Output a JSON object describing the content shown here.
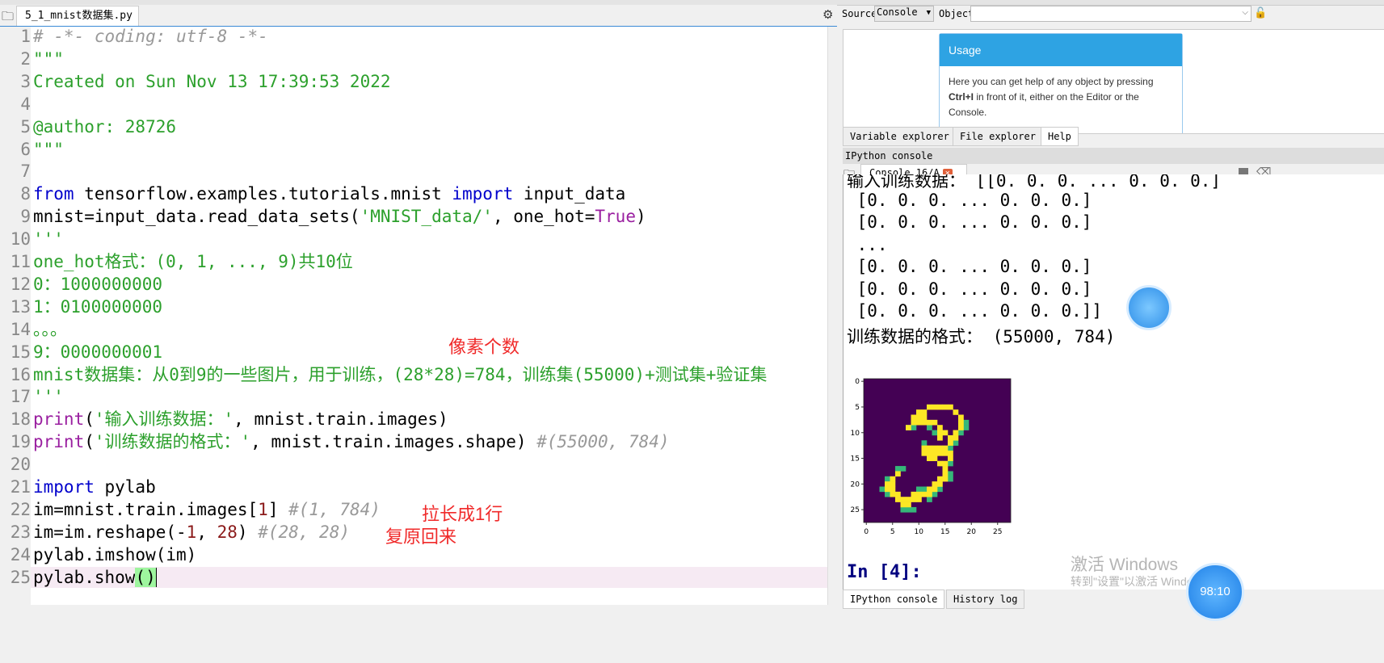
{
  "editor": {
    "file_tab": "5_1_mnist数据集.py",
    "cursor_line": 25,
    "lines": [
      [
        [
          "cm",
          "# -*- coding: utf-8 -*-"
        ]
      ],
      [
        [
          "st",
          "\"\"\""
        ]
      ],
      [
        [
          "st",
          "Created on Sun Nov 13 17:39:53 2022"
        ]
      ],
      [],
      [
        [
          "st",
          "@author: 28726"
        ]
      ],
      [
        [
          "st",
          "\"\"\""
        ]
      ],
      [],
      [
        [
          "kw",
          "from"
        ],
        [
          "pl",
          " tensorflow.examples.tutorials.mnist "
        ],
        [
          "kw",
          "import"
        ],
        [
          "pl",
          " input_data"
        ]
      ],
      [
        [
          "pl",
          "mnist=input_data.read_data_sets("
        ],
        [
          "st",
          "'MNIST_data/'"
        ],
        [
          "pl",
          ", one_hot="
        ],
        [
          "bi",
          "True"
        ],
        [
          "pl",
          ")"
        ]
      ],
      [
        [
          "st",
          "'''"
        ]
      ],
      [
        [
          "st",
          "one_hot格式：(0, 1, ..., 9)共10位"
        ]
      ],
      [
        [
          "st",
          "0：1000000000"
        ]
      ],
      [
        [
          "st",
          "1：0100000000"
        ]
      ],
      [
        [
          "st",
          "。。。"
        ]
      ],
      [
        [
          "st",
          "9：0000000001"
        ]
      ],
      [
        [
          "st",
          "mnist数据集：从0到9的一些图片，用于训练，(28*28)=784，训练集(55000)+测试集+验证集"
        ]
      ],
      [
        [
          "st",
          "'''"
        ]
      ],
      [
        [
          "bi",
          "print"
        ],
        [
          "pl",
          "("
        ],
        [
          "st",
          "'输入训练数据：'"
        ],
        [
          "pl",
          ", mnist.train.images)"
        ]
      ],
      [
        [
          "bi",
          "print"
        ],
        [
          "pl",
          "("
        ],
        [
          "st",
          "'训练数据的格式：'"
        ],
        [
          "pl",
          ", mnist.train.images.shape) "
        ],
        [
          "cm",
          "#(55000, 784)"
        ]
      ],
      [],
      [
        [
          "kw",
          "import"
        ],
        [
          "pl",
          " pylab"
        ]
      ],
      [
        [
          "pl",
          "im=mnist.train.images["
        ],
        [
          "nm",
          "1"
        ],
        [
          "pl",
          "] "
        ],
        [
          "cm",
          "#(1, 784)"
        ]
      ],
      [
        [
          "pl",
          "im=im.reshape(-"
        ],
        [
          "nm",
          "1"
        ],
        [
          "pl",
          ", "
        ],
        [
          "nm",
          "28"
        ],
        [
          "pl",
          ") "
        ],
        [
          "cm",
          "#(28, 28)"
        ]
      ],
      [
        [
          "pl",
          "pylab.imshow(im)"
        ]
      ],
      [
        [
          "pl",
          "pylab.show"
        ],
        [
          "br",
          "()"
        ]
      ]
    ],
    "annotations": [
      {
        "text": "像素个数",
        "line": 15
      },
      {
        "text": "拉长成1行",
        "line": 22
      },
      {
        "text": "复原回来",
        "line": 23
      }
    ]
  },
  "help": {
    "source_label": "Source",
    "source_value": "Console",
    "object_label": "Object",
    "object_value": "",
    "usage_title": "Usage",
    "usage_text_pre": "Here you can get help of any object by pressing ",
    "usage_text_bold": "Ctrl+I",
    "usage_text_post": " in front of it, either on the Editor or the Console.",
    "tabs": [
      "Variable explorer",
      "File explorer",
      "Help"
    ],
    "active_tab": "Help"
  },
  "console": {
    "pane_title": "IPython console",
    "tab": "Console 16/A",
    "output": [
      "输入训练数据： [[0. 0. 0. ... 0. 0. 0.]",
      " [0. 0. 0. ... 0. 0. 0.]",
      " [0. 0. 0. ... 0. 0. 0.]",
      " ...",
      " [0. 0. 0. ... 0. 0. 0.]",
      " [0. 0. 0. ... 0. 0. 0.]",
      " [0. 0. 0. ... 0. 0. 0.]]",
      "训练数据的格式： (55000, 784)"
    ],
    "plot": {
      "xticks": [
        "0",
        "5",
        "10",
        "15",
        "20",
        "25"
      ],
      "yticks": [
        "0",
        "5",
        "10",
        "15",
        "20",
        "25"
      ],
      "colormap": "viridis",
      "bg": "#440154",
      "fg": "#fde725"
    },
    "prompt": "In [4]:",
    "bottom_tabs": [
      "IPython console",
      "History log"
    ]
  },
  "overlay": {
    "watermark_1": "激活 Windows",
    "watermark_2": "转到\"设置\"以激活 Windows",
    "timer": "98:10"
  }
}
